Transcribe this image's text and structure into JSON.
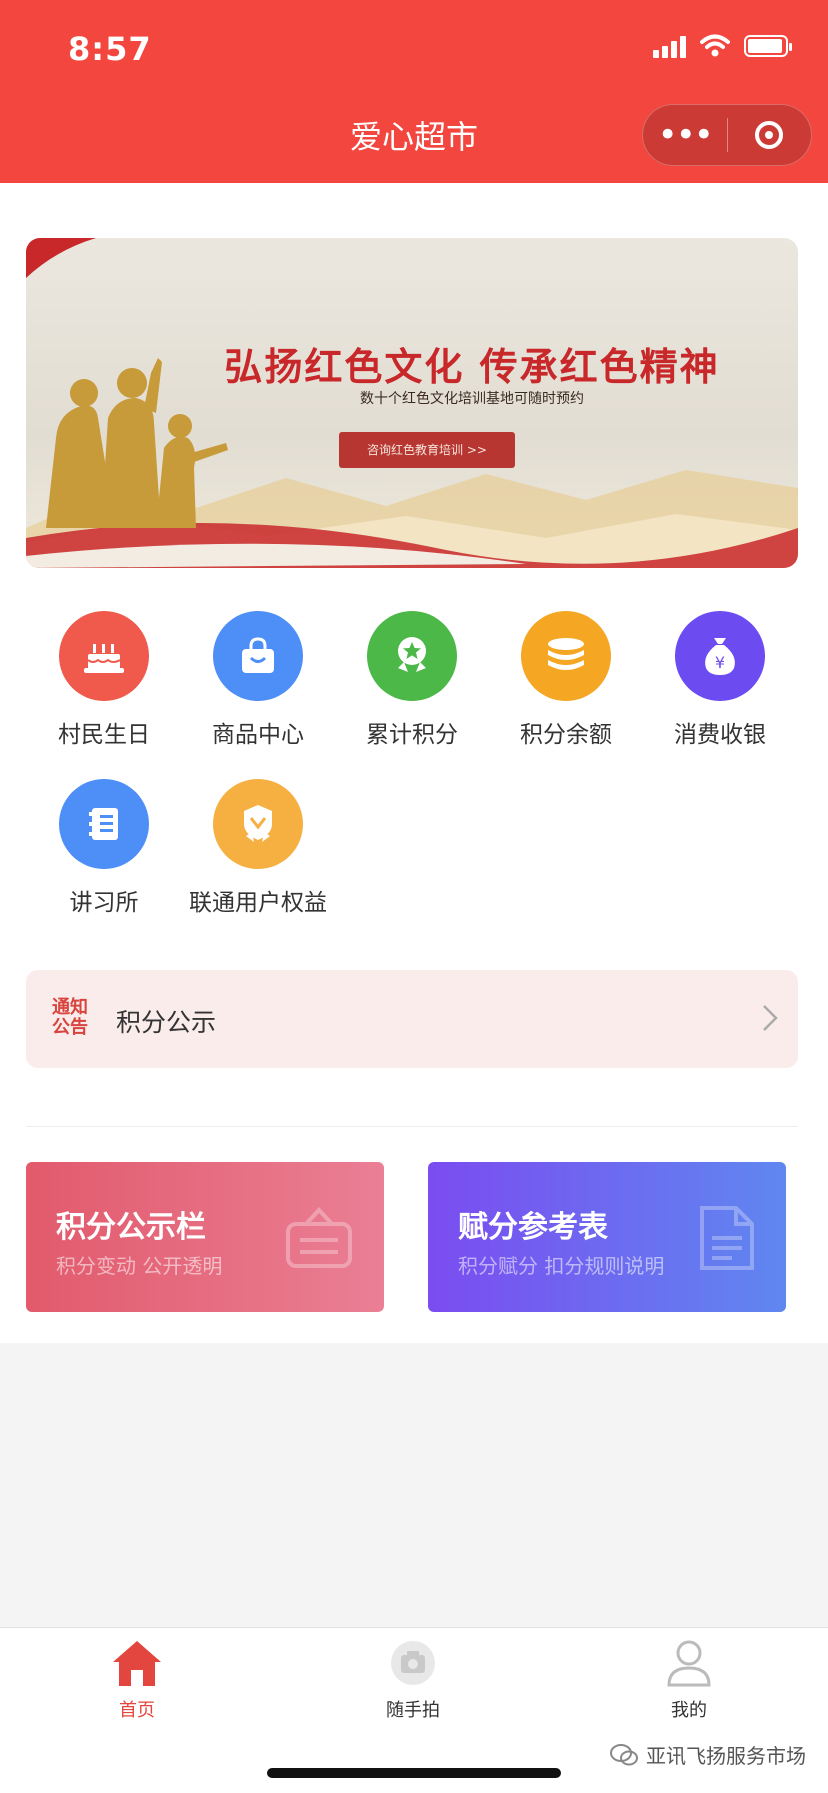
{
  "status_bar": {
    "time": "8:57"
  },
  "header": {
    "title": "爱心超市"
  },
  "banner": {
    "title": "弘扬红色文化  传承红色精神",
    "subtitle": "数十个红色文化培训基地可随时预约",
    "button": "咨询红色教育培训 >>"
  },
  "menu": [
    {
      "label": "村民生日",
      "icon": "cake-icon",
      "color": "#f05a4c"
    },
    {
      "label": "商品中心",
      "icon": "shopping-bag-icon",
      "color": "#4e8ef7"
    },
    {
      "label": "累计积分",
      "icon": "medal-icon",
      "color": "#4cb848"
    },
    {
      "label": "积分余额",
      "icon": "coins-icon",
      "color": "#f5a623"
    },
    {
      "label": "消费收银",
      "icon": "money-bag-icon",
      "color": "#6c4cf0"
    },
    {
      "label": "讲习所",
      "icon": "book-icon",
      "color": "#4e8ef7"
    },
    {
      "label": "联通用户权益",
      "icon": "badge-icon",
      "color": "#f5b041"
    }
  ],
  "notice": {
    "badge": "通知公告",
    "text": "积分公示"
  },
  "cards": [
    {
      "title": "积分公示栏",
      "subtitle": "积分变动 公开透明",
      "icon": "board-icon"
    },
    {
      "title": "赋分参考表",
      "subtitle": "积分赋分 扣分规则说明",
      "icon": "document-icon"
    }
  ],
  "tabbar": {
    "home": "首页",
    "snap": "随手拍",
    "mine": "我的"
  },
  "watermark": "亚讯飞扬服务市场",
  "colors": {
    "brand": "#f2463f",
    "accent": "#e2463f"
  }
}
